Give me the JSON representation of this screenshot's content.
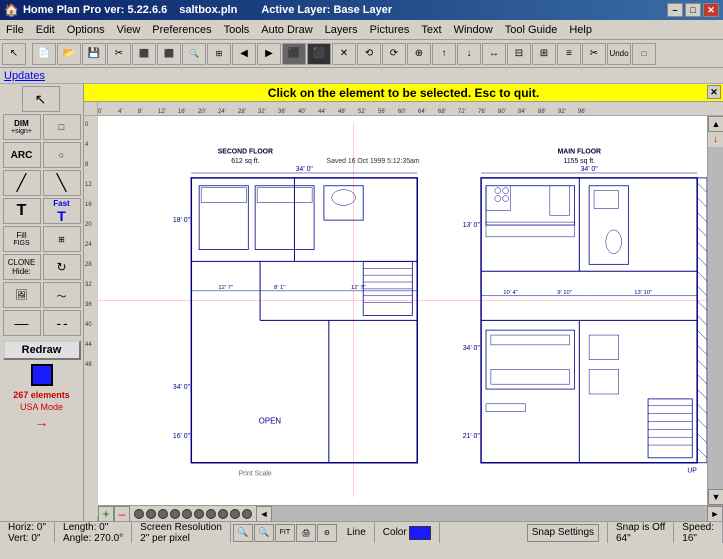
{
  "titlebar": {
    "app_name": "Home Plan Pro ver: 5.22.6.6",
    "file": "saltbox.pln",
    "layer": "Active Layer: Base Layer",
    "minimize": "–",
    "maximize": "□",
    "close": "✕"
  },
  "menubar": {
    "items": [
      "File",
      "Edit",
      "Options",
      "View",
      "Preferences",
      "Tools",
      "Auto Draw",
      "Layers",
      "Pictures",
      "Text",
      "Window",
      "Tool Guide",
      "Help"
    ]
  },
  "updates": "Updates",
  "notification": "Click on the element to be selected.  Esc to quit.",
  "left_toolbar": {
    "dim_label": "DIM",
    "dim_sign": "+sign+",
    "arc_label": "ARC",
    "fast_label": "Fast",
    "fill_label": "Fill",
    "figs_label": "FIGS",
    "clone_label": "CLONE",
    "hide_label": "Hide:",
    "redraw": "Redraw"
  },
  "drawing": {
    "second_floor_label": "SECOND FLOOR",
    "second_floor_sqft": "612 sq ft.",
    "main_floor_label": "MAIN FLOOR",
    "main_floor_sqft": "1155 sq ft.",
    "saved_label": "Saved 16 Oct 1999  5:12:35am",
    "open_label": "OPEN",
    "print_scale": "Print Scale"
  },
  "status_bar": {
    "horiz": "Horiz: 0\"",
    "vert": "Vert: 0\"",
    "length": "Length: 0\"",
    "angle": "Angle: 270.0°",
    "resolution": "Screen Resolution",
    "resolution_sub": "2\" per pixel",
    "line_label": "Line",
    "color_label": "Color",
    "snap_settings": "Snap Settings",
    "snap_off": "Snap is Off",
    "snap_size": "64\"",
    "speed_label": "Speed:",
    "speed_value": "16\"",
    "elements": "267 elements",
    "usa_mode": "USA Mode"
  },
  "ruler": {
    "h_marks": [
      "0'",
      "4'",
      "8'",
      "12'",
      "16'",
      "20'",
      "24'",
      "28'",
      "32'",
      "36'",
      "40'",
      "44'",
      "48'",
      "52'",
      "56'",
      "60'",
      "64'",
      "68'",
      "72'",
      "76'",
      "80'",
      "84'",
      "88'",
      "92'",
      "96'"
    ],
    "v_marks": [
      "0",
      "4",
      "8",
      "12",
      "16",
      "20",
      "24",
      "28",
      "32",
      "36",
      "40",
      "44",
      "48"
    ]
  }
}
